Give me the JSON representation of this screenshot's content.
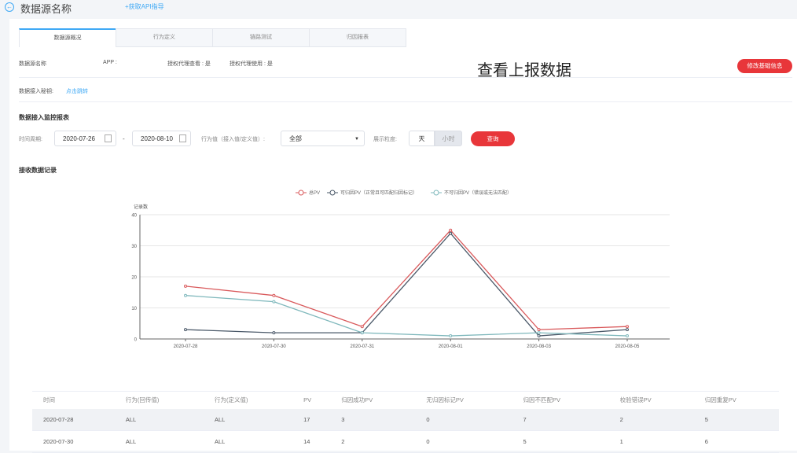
{
  "header": {
    "title": "数据源名称",
    "api_link": "+获取API指导"
  },
  "tabs": [
    "数据源概况",
    "行为定义",
    "链路测试",
    "归因报表"
  ],
  "info": {
    "name": "数据源名称",
    "app": "APP :",
    "auth_view": "授权代理查看 : 是",
    "auth_use": "授权代理使用 : 是",
    "overlay": "查看上报数据",
    "edit_button": "修改基础信息",
    "secret_label": "数据接入秘钥:",
    "secret_link": "点击跳转"
  },
  "monitor": {
    "title": "数据接入监控报表",
    "period_label": "时间周期:",
    "start_date": "2020-07-26",
    "end_date": "2020-08-10",
    "dash": "-",
    "behavior_label": "行为值（接入值/定义值）:",
    "behavior_value": "全部",
    "granularity_label": "展示粒度:",
    "day": "天",
    "hour": "小时",
    "query": "查询"
  },
  "records_title": "接收数据记录",
  "colors": {
    "accent": "#e8363a",
    "link": "#3fa9f5",
    "total": "#d9595b",
    "attr": "#4a5868",
    "nonattr": "#7fb8bc"
  },
  "chart_data": {
    "type": "line",
    "ylabel": "记录数",
    "ylim": [
      0,
      40
    ],
    "yticks": [
      0,
      10,
      20,
      30,
      40
    ],
    "categories": [
      "2020-07-28",
      "2020-07-30",
      "2020-07-31",
      "2020-08-01",
      "2020-08-03",
      "2020-08-05"
    ],
    "series": [
      {
        "name": "总PV",
        "values": [
          17,
          14,
          4,
          35,
          3,
          4
        ]
      },
      {
        "name": "可归因PV（正常且可匹配归因标记）",
        "values": [
          3,
          2,
          2,
          34,
          1,
          3
        ]
      },
      {
        "name": "不可归因PV（错误或无法匹配）",
        "values": [
          14,
          12,
          2,
          1,
          2,
          1
        ]
      }
    ],
    "legend": "top-center",
    "grid": true
  },
  "table": {
    "headers": [
      "时间",
      "行为(回传值)",
      "行为(定义值)",
      "PV",
      "归因成功PV",
      "无归因标记PV",
      "归因不匹配PV",
      "校验错误PV",
      "归因重复PV"
    ],
    "rows": [
      [
        "2020-07-28",
        "ALL",
        "ALL",
        "17",
        "3",
        "0",
        "7",
        "2",
        "5"
      ],
      [
        "2020-07-30",
        "ALL",
        "ALL",
        "14",
        "2",
        "0",
        "5",
        "1",
        "6"
      ]
    ]
  }
}
